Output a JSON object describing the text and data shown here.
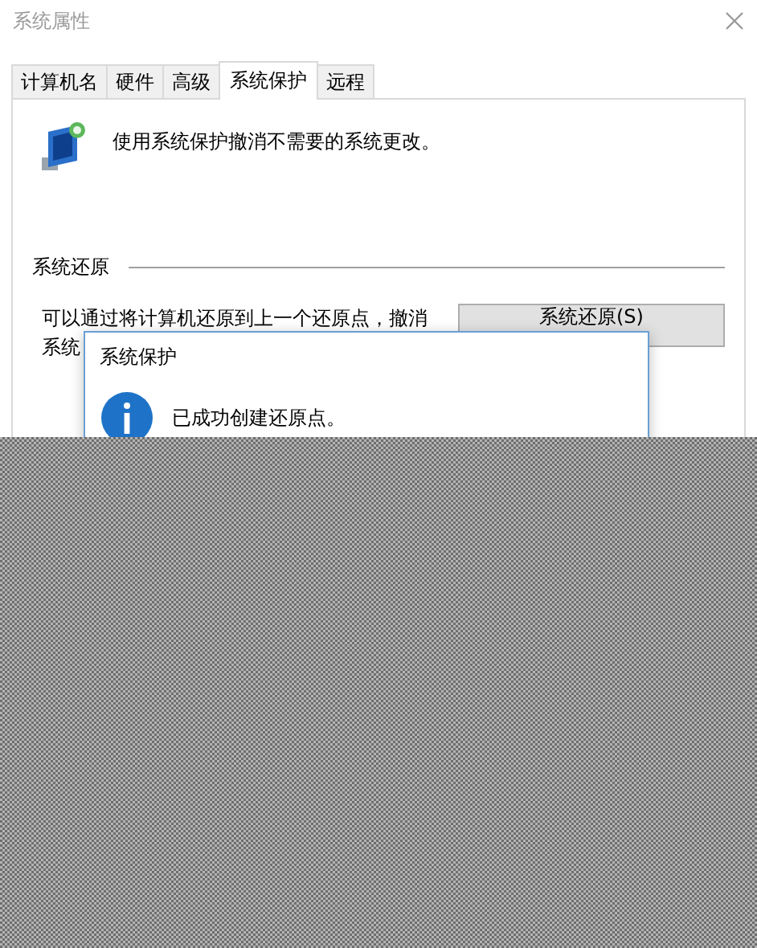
{
  "window": {
    "title": "系统属性"
  },
  "tabs": [
    {
      "label": "计算机名",
      "selected": false
    },
    {
      "label": "硬件",
      "selected": false
    },
    {
      "label": "高级",
      "selected": false
    },
    {
      "label": "系统保护",
      "selected": true
    },
    {
      "label": "远程",
      "selected": false
    }
  ],
  "header": {
    "text": "使用系统保护撤消不需要的系统更改。"
  },
  "system_restore": {
    "heading": "系统还原",
    "description_lines": [
      "可以通过将计算机还原到上一个还原点，撤消",
      "系统"
    ],
    "button": "系统还原(S)"
  },
  "message_box": {
    "title": "系统保护",
    "message": "已成功创建还原点。"
  }
}
